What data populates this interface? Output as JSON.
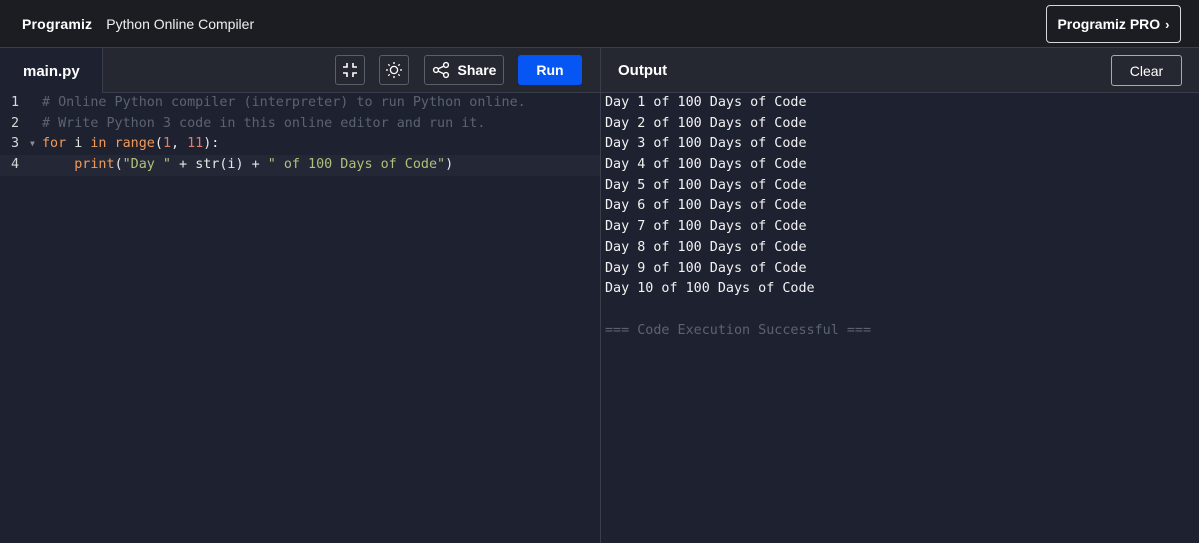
{
  "brand": {
    "logo_text": "Programiz",
    "app_title": "Python Online Compiler",
    "pro_button": "Programiz PRO",
    "pro_chevron": "›"
  },
  "toolbar": {
    "file_tab": "main.py",
    "share_label": "Share",
    "run_label": "Run",
    "output_label": "Output",
    "clear_label": "Clear",
    "icons": [
      "collapse-icon",
      "theme-toggle-icon",
      "share-icon"
    ]
  },
  "editor": {
    "lines": [
      {
        "num": "1",
        "tokens": [
          {
            "t": "comment",
            "v": "# Online Python compiler (interpreter) to run Python online."
          }
        ]
      },
      {
        "num": "2",
        "tokens": [
          {
            "t": "comment",
            "v": "# Write Python 3 code in this online editor and run it."
          }
        ]
      },
      {
        "num": "3",
        "fold": true,
        "tokens": [
          {
            "t": "kw",
            "v": "for"
          },
          {
            "t": "plain",
            "v": " i "
          },
          {
            "t": "kw",
            "v": "in"
          },
          {
            "t": "plain",
            "v": " "
          },
          {
            "t": "kw",
            "v": "range"
          },
          {
            "t": "plain",
            "v": "("
          },
          {
            "t": "num",
            "v": "1"
          },
          {
            "t": "plain",
            "v": ", "
          },
          {
            "t": "num",
            "v": "11"
          },
          {
            "t": "plain",
            "v": "):"
          }
        ]
      },
      {
        "num": "4",
        "active": true,
        "tokens": [
          {
            "t": "plain",
            "v": "    "
          },
          {
            "t": "kw",
            "v": "print"
          },
          {
            "t": "plain",
            "v": "("
          },
          {
            "t": "str",
            "v": "\"Day \""
          },
          {
            "t": "plain",
            "v": " + "
          },
          {
            "t": "plain",
            "v": "str(i)"
          },
          {
            "t": "plain",
            "v": " + "
          },
          {
            "t": "str",
            "v": "\" of 100 Days of Code\""
          },
          {
            "t": "plain",
            "v": ")"
          }
        ]
      }
    ]
  },
  "output": {
    "lines": [
      "Day 1 of 100 Days of Code",
      "Day 2 of 100 Days of Code",
      "Day 3 of 100 Days of Code",
      "Day 4 of 100 Days of Code",
      "Day 5 of 100 Days of Code",
      "Day 6 of 100 Days of Code",
      "Day 7 of 100 Days of Code",
      "Day 8 of 100 Days of Code",
      "Day 9 of 100 Days of Code",
      "Day 10 of 100 Days of Code"
    ],
    "status": "=== Code Execution Successful ==="
  },
  "colors": {
    "run_button": "#0556f3",
    "background": "#1e2130",
    "comment": "#5c6370",
    "keyword": "#f29a5a",
    "string": "#b0c07a"
  }
}
